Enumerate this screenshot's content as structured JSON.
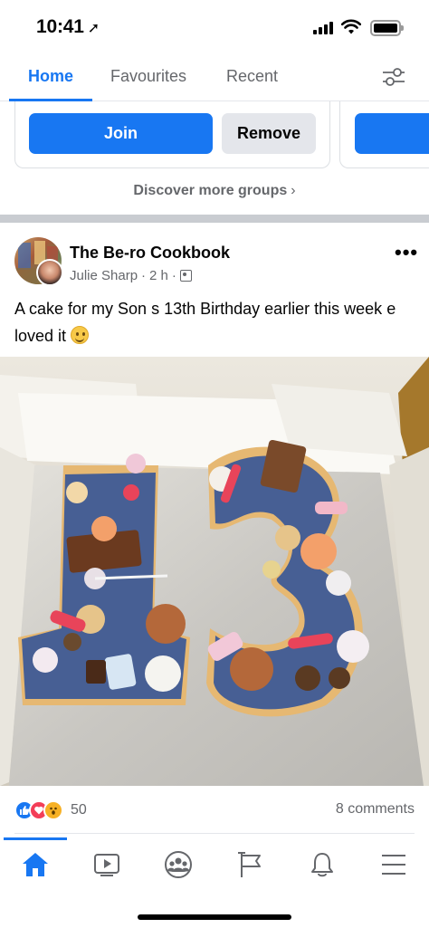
{
  "status_bar": {
    "time": "10:41",
    "location_glyph": "➚"
  },
  "tabs": [
    {
      "label": "Home",
      "active": true
    },
    {
      "label": "Favourites",
      "active": false
    },
    {
      "label": "Recent",
      "active": false
    }
  ],
  "groups": {
    "join_label": "Join",
    "remove_label": "Remove",
    "discover_label": "Discover more groups",
    "discover_chevron": "›"
  },
  "post": {
    "group_name": "The Be-ro Cookbook",
    "author": "Julie Sharp",
    "time": "2 h",
    "separator": "·",
    "more_glyph": "•••",
    "text": "A cake for my Son s 13th Birthday earlier this week e loved it",
    "reaction_count": "50",
    "comments_label": "8 comments"
  },
  "colors": {
    "accent": "#1877f2",
    "secondary_text": "#65676b",
    "button_grey": "#e4e6eb",
    "separator": "#c9ccd1"
  },
  "icons": {
    "filter": "sliders-icon",
    "home": "home-icon",
    "video": "video-icon",
    "groups": "groups-icon",
    "pages": "flag-icon",
    "notifications": "bell-icon",
    "menu": "menu-icon"
  }
}
